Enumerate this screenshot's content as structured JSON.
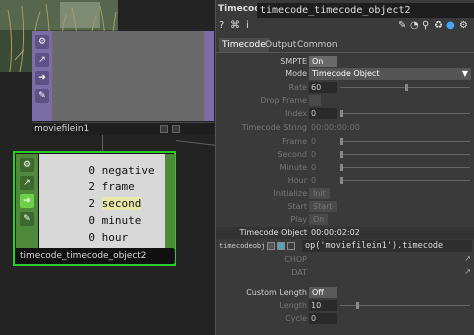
{
  "network": {
    "moviefilein": {
      "label": "moviefilein1",
      "sidebar_icons": [
        "gear-icon",
        "pulse-icon",
        "arrow-right-icon",
        "bypass-icon"
      ]
    },
    "timecode": {
      "label": "timecode_timecode_object2",
      "channels": [
        {
          "value": "0",
          "name": "negative"
        },
        {
          "value": "2",
          "name": "frame"
        },
        {
          "value": "2",
          "name": "second"
        },
        {
          "value": "0",
          "name": "minute"
        },
        {
          "value": "0",
          "name": "hour"
        }
      ]
    }
  },
  "panel": {
    "op_type": "Timecode",
    "op_name": "timecode_timecode_object2",
    "toolbar_glyphs": [
      "?",
      "⌘",
      "i"
    ],
    "tabs": [
      "Timecode",
      "Output",
      "Common"
    ],
    "params": {
      "smpte": {
        "label": "SMPTE",
        "value": "On"
      },
      "mode": {
        "label": "Mode",
        "value": "Timecode Object"
      },
      "rate": {
        "label": "Rate",
        "value": "60"
      },
      "dropframe": {
        "label": "Drop Frame",
        "value": ""
      },
      "index": {
        "label": "Index",
        "value": "0"
      },
      "tcstring": {
        "label": "Timecode String",
        "value": "00:00:00:00"
      },
      "frame": {
        "label": "Frame",
        "value": "0"
      },
      "second": {
        "label": "Second",
        "value": "0"
      },
      "minute": {
        "label": "Minute",
        "value": "0"
      },
      "hour": {
        "label": "Hour",
        "value": "0"
      },
      "initialize": {
        "label": "Initialize",
        "value": "Init"
      },
      "start": {
        "label": "Start",
        "value": "Start"
      },
      "play": {
        "label": "Play",
        "value": "On"
      },
      "tcobj": {
        "label": "Timecode Object",
        "value": "00:00:02:02"
      },
      "tcobj_expr": {
        "label": "timecodeobj",
        "value": "op('moviefilein1').timecode"
      },
      "chop": {
        "label": "CHOP",
        "value": ""
      },
      "dat": {
        "label": "DAT",
        "value": ""
      },
      "custom_length": {
        "label": "Custom Length",
        "value": "Off"
      },
      "length": {
        "label": "Length",
        "value": "10"
      },
      "cycle": {
        "label": "Cycle",
        "value": "0"
      }
    }
  }
}
